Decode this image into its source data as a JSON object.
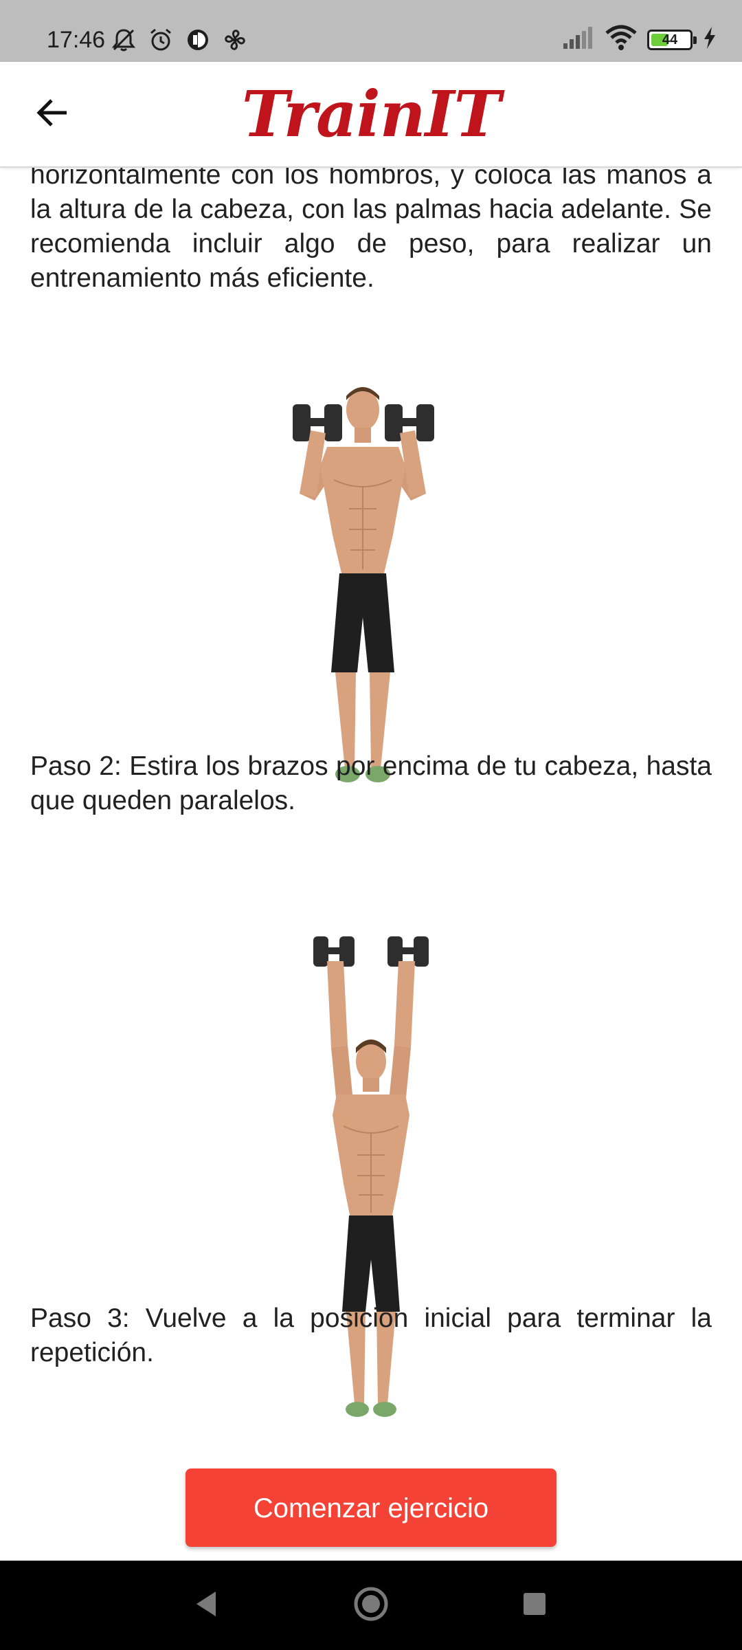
{
  "status_bar": {
    "time": "17:46",
    "battery_level": "44",
    "battery_fraction": 0.44,
    "icons_left": [
      "muted-alarm-icon",
      "alarm-icon",
      "app-notification-icon",
      "fan-icon"
    ],
    "icons_right": [
      "signal-icon",
      "wifi-icon",
      "battery-icon",
      "charging-icon"
    ]
  },
  "app_bar": {
    "title": "TrainIT",
    "brand_color": "#c0141c",
    "back_icon": "arrow-back-icon"
  },
  "content": {
    "intro_text": "horizontalmente con los hombros, y coloca las manos a la altura de la cabeza, con las palmas hacia adelante. Se recomienda incluir algo de peso, para realizar un entrenamiento más eficiente.",
    "step2_text": "Paso 2: Estira los brazos por encima de tu cabeza, hasta que queden paralelos.",
    "step3_text": "Paso 3: Vuelve a la posición inicial para terminar la repetición."
  },
  "actions": {
    "start_button_label": "Comenzar ejercicio",
    "accent_color": "#f44336"
  },
  "nav_bar": {
    "icons": [
      "nav-back-icon",
      "nav-home-icon",
      "nav-recents-icon"
    ]
  }
}
